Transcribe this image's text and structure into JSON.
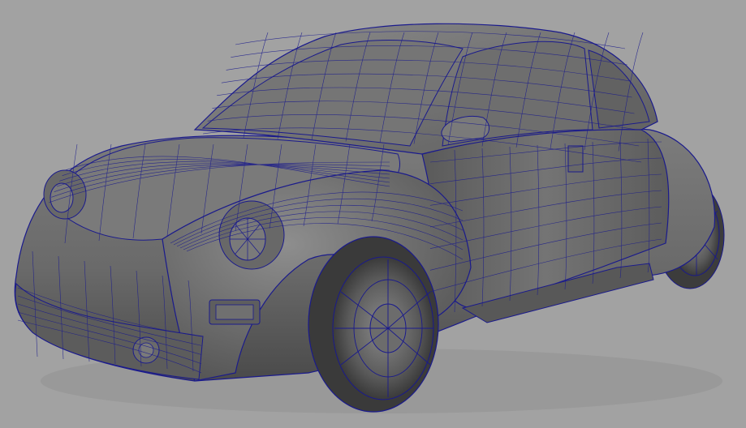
{
  "viewport": {
    "background_color": "#a2a2a2",
    "mesh": {
      "subject": "car-wireframe-model",
      "shading": "smooth-shaded-gray",
      "wire_color": "#1a1a8c",
      "surface_color": "#6e6e6e"
    }
  }
}
